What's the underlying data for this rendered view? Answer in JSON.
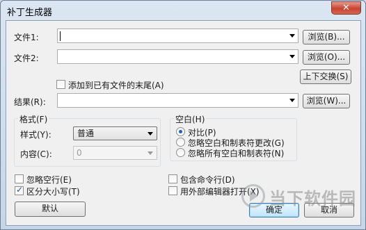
{
  "window": {
    "title": "补丁生成器",
    "close_glyph": "✕"
  },
  "file1": {
    "label": "文件1:",
    "value": "",
    "browse": "浏览(B)..."
  },
  "file2": {
    "label": "文件2:",
    "value": "",
    "browse": "浏览(O)..."
  },
  "swap_button": "上下交换(S)",
  "append_checkbox": {
    "label": "添加到已有文件的末尾(A)",
    "checked": false
  },
  "result": {
    "label": "结果(R):",
    "value": "",
    "browse": "浏览(W)..."
  },
  "format_group": {
    "title": "格式(F)",
    "style_label": "样式(Y):",
    "style_value": "普通",
    "content_label": "内容(C):",
    "content_value": "0"
  },
  "whitespace_group": {
    "title": "空白(H)",
    "options": [
      {
        "label": "对比(P)",
        "selected": true
      },
      {
        "label": "忽略空白和制表符更改(G)",
        "selected": false
      },
      {
        "label": "忽略所有空白和制表符(N)",
        "selected": false
      }
    ]
  },
  "options": {
    "ignore_blank_lines": {
      "label": "忽略空行(E)",
      "checked": false
    },
    "case_sensitive": {
      "label": "区分大小写(T)",
      "checked": true
    },
    "include_cmdline": {
      "label": "包含命令行(D)",
      "checked": false
    },
    "external_editor": {
      "label": "用外部编辑器打开(X)",
      "checked": false
    }
  },
  "buttons": {
    "default": "默认",
    "ok": "确定",
    "cancel": "取消"
  },
  "watermark": {
    "text": "当下软件园"
  }
}
